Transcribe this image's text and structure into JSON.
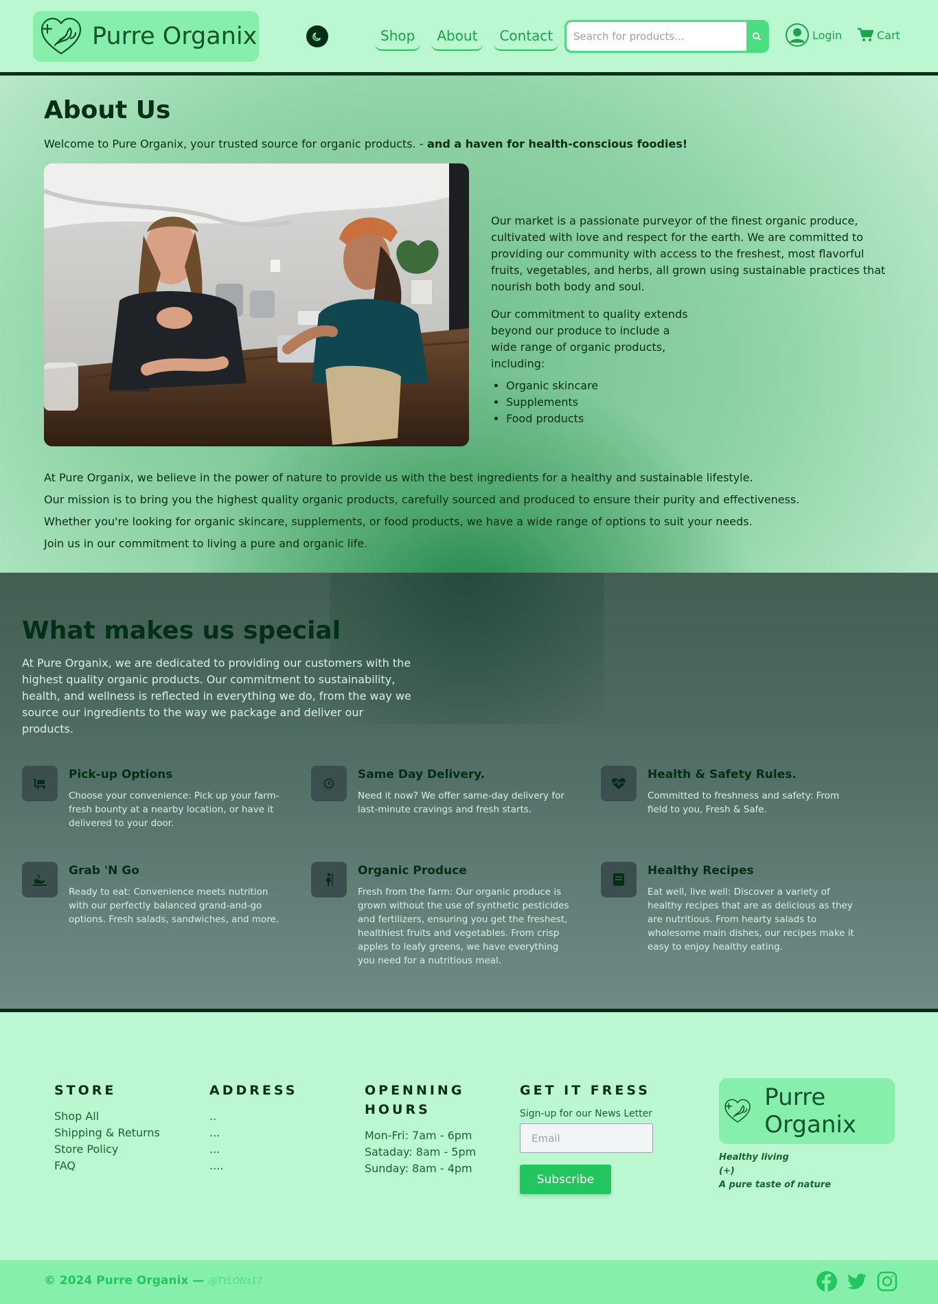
{
  "header": {
    "brand": "Purre Organix",
    "nav": [
      "Shop",
      "About",
      "Contact"
    ],
    "search_placeholder": "Search for products...",
    "login": "Login",
    "cart": "Cart"
  },
  "about": {
    "title": "About Us",
    "welcome": "Welcome to Pure Organix, your trusted source for organic products. -",
    "welcome_bold": " and a haven for health-conscious foodies!",
    "market": "Our market is a passionate purveyor of the finest organic produce, cultivated with love and respect for the earth. We are committed to providing our community with access to the freshest, most flavorful fruits, vegetables, and herbs, all grown using sustainable practices that nourish both body and soul.",
    "commitment": "Our commitment to quality extends beyond our produce to include a wide range of organic products, including:",
    "products": [
      "Organic skincare",
      "Supplements",
      "Food products"
    ],
    "paragraphs": [
      "At Pure Organix, we believe in the power of nature to provide us with the best ingredients for a healthy and sustainable lifestyle.",
      "Our mission is to bring you the highest quality organic products, carefully sourced and produced to ensure their purity and effectiveness.",
      "Whether you're looking for organic skincare, supplements, or food products, we have a wide range of options to suit your needs.",
      "Join us in our commitment to living a pure and organic life."
    ]
  },
  "special": {
    "title": "What makes us special",
    "intro": "At Pure Organix, we are dedicated to providing our customers with the highest quality organic products. Our commitment to sustainability, health, and wellness is reflected in everything we do, from the way we source our ingredients to the way we package and deliver our products.",
    "features": [
      {
        "title": "Pick-up Options",
        "text": "Choose your convenience: Pick up your farm-fresh bounty at a nearby location, or have it delivered to your door.",
        "icon": "cart-icon"
      },
      {
        "title": "Same Day Delivery.",
        "text": "Need it now? We offer same-day delivery for last-minute cravings and fresh starts.",
        "icon": "clock-icon"
      },
      {
        "title": "Health & Safety Rules.",
        "text": "Committed to freshness and safety: From field to you, Fresh & Safe.",
        "icon": "heartbeat-icon"
      },
      {
        "title": "Grab 'N Go",
        "text": "Ready to eat: Convenience meets nutrition with our perfectly balanced grand-and-go options. Fresh salads, sandwiches, and more.",
        "icon": "hand-icon"
      },
      {
        "title": "Organic Produce",
        "text": "Fresh from the farm: Our organic produce is grown without the use of synthetic pesticides and fertilizers, ensuring you get the freshest, healthiest fruits and vegetables. From crisp apples to leafy greens, we have everything you need for a nutritious meal.",
        "icon": "farmer-icon"
      },
      {
        "title": "Healthy Recipes",
        "text": "Eat well, live well: Discover a variety of healthy recipes that are as delicious as they are nutritious. From hearty salads to wholesome main dishes, our recipes make it easy to enjoy healthy eating.",
        "icon": "book-icon"
      }
    ]
  },
  "footer": {
    "store_title": "STORE",
    "store_links": [
      "Shop All",
      "Shipping & Returns",
      "Store Policy",
      "FAQ"
    ],
    "address_title": "ADDRESS",
    "address_lines": [
      "..",
      "...",
      "...",
      "...."
    ],
    "hours_title": "OPENNING HOURS",
    "hours": [
      "Mon-Fri: 7am - 6pm",
      "Sataday: 8am - 5pm",
      "Sunday: 8am - 4pm"
    ],
    "news_title": "GET IT FRESS",
    "news_label": "Sign-up for our News Letter",
    "email_placeholder": "Email",
    "subscribe": "Subscribe",
    "brand": "Purre Organix",
    "tagline": [
      "Healthy living",
      "(+)",
      "A pure taste of nature"
    ],
    "copyright": "© 2024 Purre Organix —",
    "handle": "@TYLONs17",
    "socials": [
      "facebook-icon",
      "twitter-icon",
      "instagram-icon"
    ]
  },
  "colors": {
    "background": "#bbf7d0",
    "accent": "#22c55e",
    "logo_bg": "#86efac",
    "dark": "#052e16"
  }
}
